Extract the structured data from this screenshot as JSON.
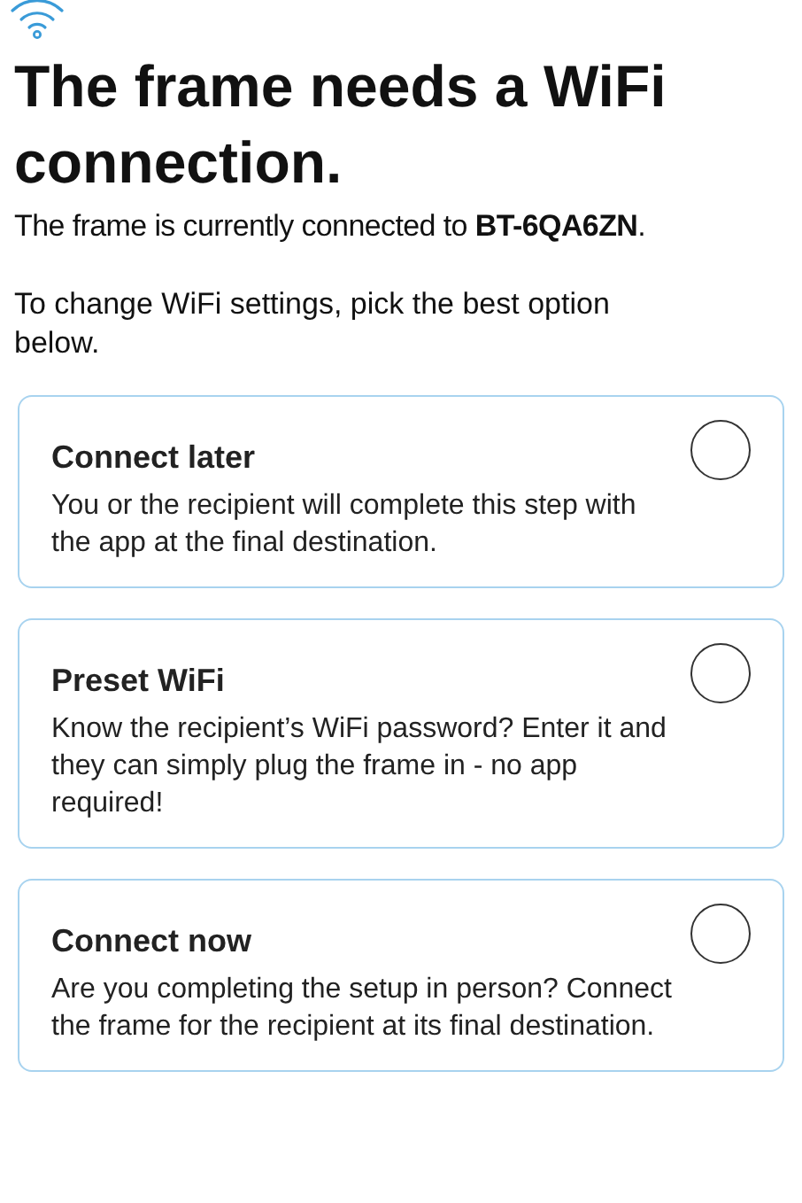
{
  "title": "The frame needs a WiFi connection.",
  "status": "The frame is currently connected to **BT-6QA6ZN**.",
  "instruction": "To change WiFi settings, pick the best option below.",
  "options": [
    {
      "title": "Connect later",
      "description": "You or the recipient will complete this step with the app at the final destination.",
      "selected": false
    },
    {
      "title": "Preset WiFi",
      "description": "Know the recipient’s WiFi password? Enter it and they can simply plug the frame in - no app required!",
      "selected": false
    },
    {
      "title": "Connect now",
      "description": "Are you completing the setup in person? Connect the frame for the recipient at its final destination.",
      "selected": false
    }
  ]
}
